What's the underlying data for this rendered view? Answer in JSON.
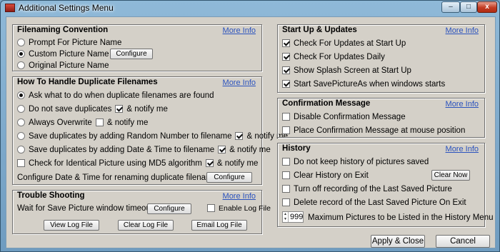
{
  "window": {
    "title": "Additional Settings Menu",
    "caption_buttons": {
      "minimize": "–",
      "maximize": "□",
      "close": "x"
    }
  },
  "more_info": "More Info",
  "filenaming": {
    "title": "Filenaming Convention",
    "options": [
      "Prompt For Picture Name",
      "Custom Picture Name",
      "Original Picture Name"
    ],
    "selected": 1,
    "configure": "Configure"
  },
  "duplicates": {
    "title": "How To Handle Duplicate Filenames",
    "options": [
      "Ask what to do when duplicate filenames are found",
      "Do not save duplicates",
      "Always Overwrite",
      "Save duplicates by adding Random Number to filename",
      "Save duplicates by adding Date & Time to filename"
    ],
    "selected": 0,
    "notify_label": "& notify me",
    "md5_label": "Check for Identical Picture using MD5 algorithm",
    "config_datetime_label": "Configure Date & Time for renaming duplicate filenames",
    "configure": "Configure"
  },
  "trouble": {
    "title": "Trouble Shooting",
    "timeout_label": "Wait for Save Picture window timeout",
    "configure": "Configure",
    "enable_log": "Enable Log File",
    "view_log": "View Log File",
    "clear_log": "Clear Log File",
    "email_log": "Email Log File"
  },
  "startup": {
    "title": "Start Up & Updates",
    "items": [
      {
        "label": "Check For Updates at Start Up",
        "checked": true
      },
      {
        "label": "Check For Updates Daily",
        "checked": true
      },
      {
        "label": "Show Splash Screen at Start Up",
        "checked": true
      },
      {
        "label": "Start SavePictureAs when windows starts",
        "checked": true
      }
    ]
  },
  "confirmation": {
    "title": "Confirmation Message",
    "items": [
      {
        "label": "Disable Confirmation Message",
        "checked": false
      },
      {
        "label": "Place Confirmation Message at mouse position",
        "checked": false
      }
    ]
  },
  "history": {
    "title": "History",
    "items": [
      {
        "label": "Do not keep history of pictures saved",
        "checked": false
      },
      {
        "label": "Clear History on Exit",
        "checked": false
      },
      {
        "label": "Turn off recording of the Last Saved Picture",
        "checked": false
      },
      {
        "label": "Delete record of the Last Saved Picture On Exit",
        "checked": false
      }
    ],
    "clear_now": "Clear Now",
    "max_value": "999",
    "max_label": "Maximum Pictures to be Listed in the History Menu"
  },
  "footer": {
    "apply": "Apply & Close",
    "cancel": "Cancel"
  }
}
